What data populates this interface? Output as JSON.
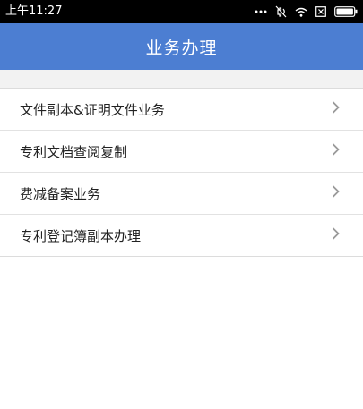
{
  "status_bar": {
    "time": "上午11:27",
    "icons": [
      "dots-icon",
      "mute-icon",
      "wifi-icon",
      "close-box-icon",
      "battery-icon"
    ]
  },
  "header": {
    "title": "业务办理",
    "background_color": "#4c7ed2"
  },
  "menu": {
    "items": [
      {
        "label": "文件副本&证明文件业务",
        "icon": "chevron-right-icon"
      },
      {
        "label": "专利文档查阅复制",
        "icon": "chevron-right-icon"
      },
      {
        "label": "费减备案业务",
        "icon": "chevron-right-icon"
      },
      {
        "label": "专利登记簿副本办理",
        "icon": "chevron-right-icon"
      }
    ]
  }
}
